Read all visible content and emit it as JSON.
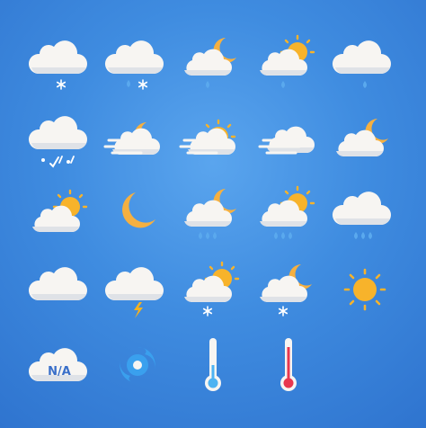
{
  "colors": {
    "background": "#3f8ce0",
    "cloud": "#f7f5f2",
    "cloud_shade": "#d9dde3",
    "sun": "#f7b32b",
    "moon": "#f5b041",
    "rain": "#5aa9ee",
    "snow": "#ffffff",
    "lightning": "#f6b21e",
    "cyclone": "#3aa0ee",
    "thermometer_cold": "#4db3f2",
    "thermometer_hot": "#e8374f"
  },
  "icons": [
    {
      "id": 1,
      "name": "cloud-snow-icon"
    },
    {
      "id": 2,
      "name": "cloud-sleet-icon"
    },
    {
      "id": 3,
      "name": "moon-cloud-rain-icon"
    },
    {
      "id": 4,
      "name": "sun-cloud-rain-icon"
    },
    {
      "id": 5,
      "name": "cloud-rain-icon"
    },
    {
      "id": 6,
      "name": "cloud-hail-mixed-icon"
    },
    {
      "id": 7,
      "name": "moon-fog-icon"
    },
    {
      "id": 8,
      "name": "sun-fog-icon"
    },
    {
      "id": 9,
      "name": "cloud-fog-icon"
    },
    {
      "id": 10,
      "name": "moon-cloud-icon"
    },
    {
      "id": 11,
      "name": "sun-cloud-icon"
    },
    {
      "id": 12,
      "name": "moon-icon"
    },
    {
      "id": 13,
      "name": "moon-cloud-heavy-rain-icon"
    },
    {
      "id": 14,
      "name": "sun-cloud-heavy-rain-icon"
    },
    {
      "id": 15,
      "name": "cloud-heavy-rain-icon"
    },
    {
      "id": 16,
      "name": "cloudy-icon"
    },
    {
      "id": 17,
      "name": "cloud-lightning-icon"
    },
    {
      "id": 18,
      "name": "sun-cloud-snow-icon"
    },
    {
      "id": 19,
      "name": "moon-cloud-snow-icon"
    },
    {
      "id": 20,
      "name": "sun-icon"
    },
    {
      "id": 21,
      "name": "not-available-cloud-icon",
      "text": "N/A"
    },
    {
      "id": 22,
      "name": "hurricane-icon"
    },
    {
      "id": 23,
      "name": "thermometer-cold-icon"
    },
    {
      "id": 24,
      "name": "thermometer-hot-icon"
    }
  ]
}
